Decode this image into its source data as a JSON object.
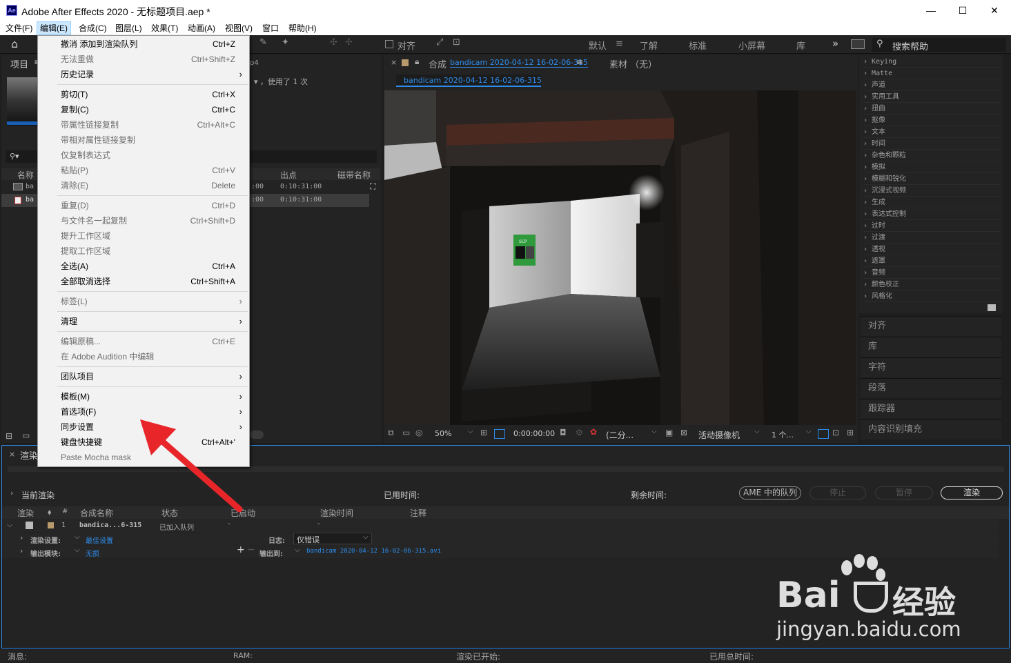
{
  "titlebar": {
    "title": "Adobe After Effects 2020 - 无标题项目.aep *",
    "logo": "Ae",
    "minimize": "—",
    "maximize": "☐",
    "close": "✕"
  },
  "menubar": [
    {
      "label": "文件(F)"
    },
    {
      "label": "编辑(E)"
    },
    {
      "label": "合成(C)"
    },
    {
      "label": "图层(L)"
    },
    {
      "label": "效果(T)"
    },
    {
      "label": "动画(A)"
    },
    {
      "label": "视图(V)"
    },
    {
      "label": "窗口"
    },
    {
      "label": "帮助(H)"
    }
  ],
  "toolbar": {
    "align_label": "对齐",
    "search_help": "搜索帮助",
    "overflow": "»"
  },
  "workspaces": [
    "默认",
    "≡",
    "了解",
    "标准",
    "小屏幕",
    "库"
  ],
  "edit_menu": [
    {
      "label": "撤消 添加到渲染队列",
      "shortcut": "Ctrl+Z"
    },
    {
      "label": "无法重做",
      "shortcut": "Ctrl+Shift+Z"
    },
    {
      "label": "历史记录",
      "arrow": "›"
    },
    {
      "label": "剪切(T)",
      "shortcut": "Ctrl+X"
    },
    {
      "label": "复制(C)",
      "shortcut": "Ctrl+C"
    },
    {
      "label": "带属性链接复制",
      "shortcut": "Ctrl+Alt+C"
    },
    {
      "label": "带相对属性链接复制"
    },
    {
      "label": "仅复制表达式"
    },
    {
      "label": "粘贴(P)",
      "shortcut": "Ctrl+V"
    },
    {
      "label": "清除(E)",
      "shortcut": "Delete"
    },
    {
      "label": "重复(D)",
      "shortcut": "Ctrl+D"
    },
    {
      "label": "与文件名一起复制",
      "shortcut": "Ctrl+Shift+D"
    },
    {
      "label": "提升工作区域"
    },
    {
      "label": "提取工作区域"
    },
    {
      "label": "全选(A)",
      "shortcut": "Ctrl+A"
    },
    {
      "label": "全部取消选择",
      "shortcut": "Ctrl+Shift+A"
    },
    {
      "label": "标签(L)",
      "arrow": "›"
    },
    {
      "label": "清理",
      "arrow": "›"
    },
    {
      "label": "编辑原稿...",
      "shortcut": "Ctrl+E"
    },
    {
      "label": "在 Adobe Audition 中编辑"
    },
    {
      "label": "团队项目",
      "arrow": "›"
    },
    {
      "label": "模板(M)",
      "arrow": "›"
    },
    {
      "label": "首选项(F)",
      "arrow": "›"
    },
    {
      "label": "同步设置",
      "arrow": "›"
    },
    {
      "label": "键盘快捷键",
      "shortcut": "Ctrl+Alt+'"
    },
    {
      "label": "Paste Mocha mask"
    }
  ],
  "project_panel": {
    "tab": "项目",
    "tab_menu": "≡",
    "file_ext": "p4",
    "usage": "▾ ，使用了 1 次",
    "search_icon": "⚲▾",
    "columns": [
      "名称",
      "出点",
      "磁带名称"
    ],
    "rows": [
      {
        "name": "ba",
        "in": ":00",
        "out": "0:10:31:00"
      },
      {
        "name": "ba",
        "in": ":00",
        "out": "0:10:31:00"
      }
    ]
  },
  "composition": {
    "tab_prefix": "合成",
    "tab_name": "bandicam 2020-04-12 16-02-06-315",
    "tab_menu": "≡",
    "footage_tab": "素材 （无）",
    "subtab": "bandicam 2020-04-12 16-02-06-315",
    "zoom": "50%",
    "timecode": "0:00:00:00",
    "resolution": "(二分...",
    "camera": "活动摄像机",
    "views": "1 个...",
    "poster_title": "SCP"
  },
  "effects_list": [
    "Keying",
    "Matte",
    "声道",
    "实用工具",
    "扭曲",
    "抠像",
    "文本",
    "时间",
    "杂色和颗粒",
    "模拟",
    "模糊和锐化",
    "沉浸式视频",
    "生成",
    "表达式控制",
    "过时",
    "过渡",
    "透视",
    "遮罩",
    "音频",
    "颜色校正",
    "风格化"
  ],
  "right_panels": [
    "对齐",
    "库",
    "字符",
    "段落",
    "跟踪器",
    "内容识别填充"
  ],
  "render_queue": {
    "tab": "渲染",
    "current_render": "当前渲染",
    "elapsed": "已用时间:",
    "remaining": "剩余时间:",
    "buttons": {
      "ame": "AME 中的队列",
      "stop": "停止",
      "pause": "暂停",
      "render": "渲染"
    },
    "columns": [
      "渲染",
      "#",
      "合成名称",
      "状态",
      "已启动",
      "渲染时间",
      "注释"
    ],
    "item": {
      "index": "1",
      "name": "bandica...6-315",
      "status": "已加入队列",
      "started": "-",
      "render_time": "-"
    },
    "render_settings_label": "渲染设置:",
    "render_settings_value": "最佳设置",
    "log_label": "日志:",
    "log_value": "仅错误",
    "output_module_label": "输出模块:",
    "output_module_value": "无损",
    "output_to_label": "输出到:",
    "output_to_value": "bandicam 2020-04-12 16-02-06-315.avi"
  },
  "status_bar": {
    "message": "消息:",
    "ram": "RAM:",
    "render_started": "渲染已开始:",
    "total_time": "已用总时间:"
  },
  "watermark": {
    "brand": "Bai",
    "brand_cn": "经验",
    "url": "jingyan.baidu.com"
  },
  "colors": {
    "accent": "#2d8ceb",
    "arrow": "#e8262a",
    "menu_bg": "#f2f2f2",
    "panel": "#232323"
  }
}
